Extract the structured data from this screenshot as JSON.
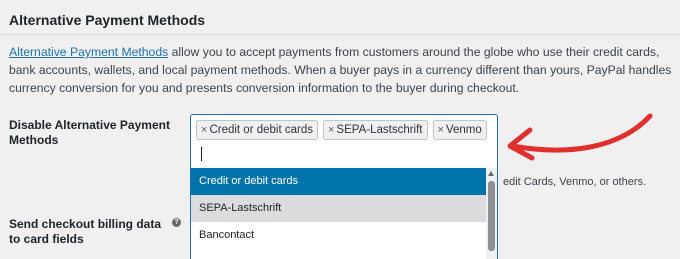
{
  "section": {
    "title": "Alternative Payment Methods"
  },
  "description": {
    "link_text": "Alternative Payment Methods",
    "text": " allow you to accept payments from customers around the globe who use their credit cards, bank accounts, wallets, and local payment methods. When a buyer pays in a currency different than yours, PayPal handles currency conversion for you and presents conversion information to the buyer during checkout."
  },
  "disable_field": {
    "label": "Disable Alternative Payment Methods",
    "chips": [
      {
        "x_icon": "×",
        "label": "Credit or debit cards"
      },
      {
        "x_icon": "×",
        "label": "SEPA-Lastschrift"
      },
      {
        "x_icon": "×",
        "label": "Venmo"
      }
    ],
    "search_value": "",
    "help_text_partial": "edit Cards, Venmo, or others."
  },
  "dropdown": {
    "options": [
      {
        "label": "Credit or debit cards",
        "state": "highlighted"
      },
      {
        "label": "SEPA-Lastschrift",
        "state": "selected"
      },
      {
        "label": "Bancontact",
        "state": "normal"
      }
    ]
  },
  "billing_field": {
    "label": "Send checkout billing data to card fields",
    "help_icon": "help-icon",
    "help_glyph": "?"
  },
  "colors": {
    "accent": "#2271b1",
    "highlight": "#0073aa",
    "annotation": "#e0302e"
  }
}
